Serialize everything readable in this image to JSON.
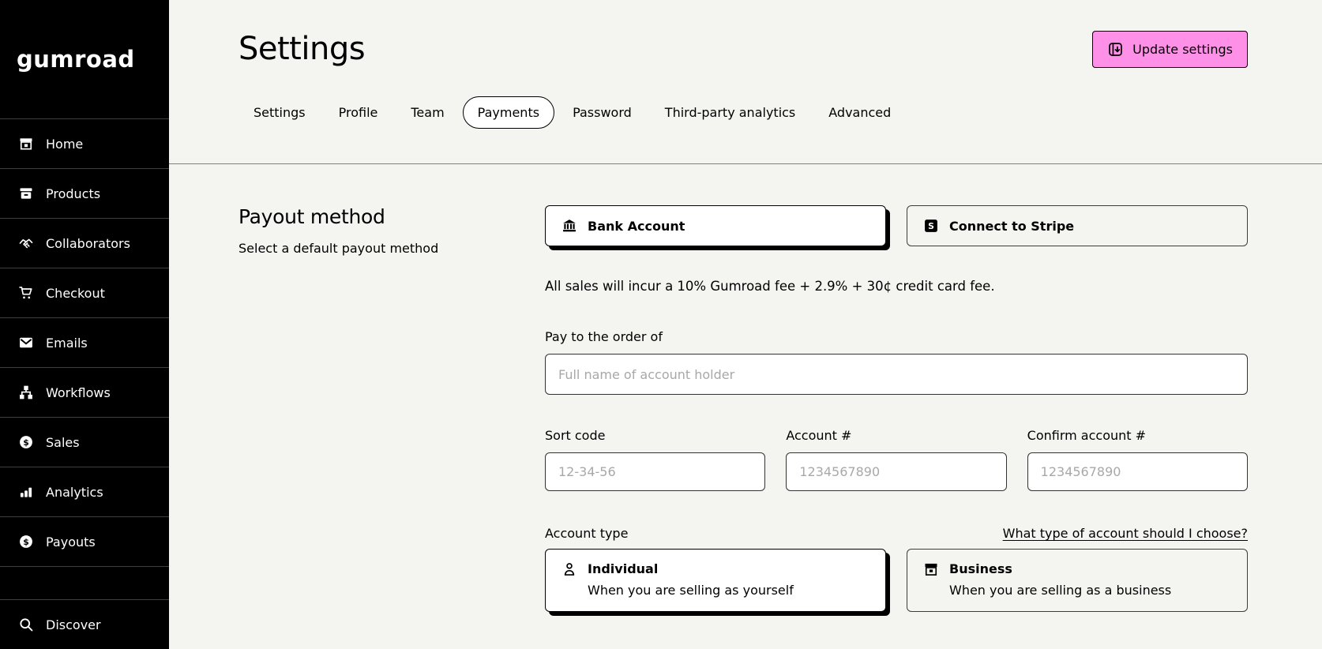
{
  "colors": {
    "accent_pink": "#ff90e8",
    "background": "#f4f4f0",
    "sidebar": "#000000"
  },
  "sidebar": {
    "logo": "gumroad",
    "items": [
      {
        "label": "Home"
      },
      {
        "label": "Products"
      },
      {
        "label": "Collaborators"
      },
      {
        "label": "Checkout"
      },
      {
        "label": "Emails"
      },
      {
        "label": "Workflows"
      },
      {
        "label": "Sales"
      },
      {
        "label": "Analytics"
      },
      {
        "label": "Payouts"
      }
    ],
    "bottom_item": {
      "label": "Discover"
    }
  },
  "header": {
    "title": "Settings",
    "update_button": "Update settings",
    "tabs": [
      {
        "label": "Settings"
      },
      {
        "label": "Profile"
      },
      {
        "label": "Team"
      },
      {
        "label": "Payments",
        "active": true
      },
      {
        "label": "Password"
      },
      {
        "label": "Third-party analytics"
      },
      {
        "label": "Advanced"
      }
    ]
  },
  "payout": {
    "section_title": "Payout method",
    "section_subtitle": "Select a default payout method",
    "methods": [
      {
        "label": "Bank Account",
        "selected": true
      },
      {
        "label": "Connect to Stripe",
        "selected": false
      }
    ],
    "fee_note": "All sales will incur a 10% Gumroad fee + 2.9% + 30¢ credit card fee.",
    "fields": {
      "pay_to": {
        "label": "Pay to the order of",
        "placeholder": "Full name of account holder",
        "value": ""
      },
      "sort_code": {
        "label": "Sort code",
        "placeholder": "12-34-56",
        "value": ""
      },
      "account_number": {
        "label": "Account #",
        "placeholder": "1234567890",
        "value": ""
      },
      "confirm_account_number": {
        "label": "Confirm account #",
        "placeholder": "1234567890",
        "value": ""
      }
    },
    "account_type": {
      "label": "Account type",
      "help_link": "What type of account should I choose?",
      "options": [
        {
          "title": "Individual",
          "description": "When you are selling as yourself",
          "selected": true
        },
        {
          "title": "Business",
          "description": "When you are selling as a business",
          "selected": false
        }
      ]
    }
  }
}
